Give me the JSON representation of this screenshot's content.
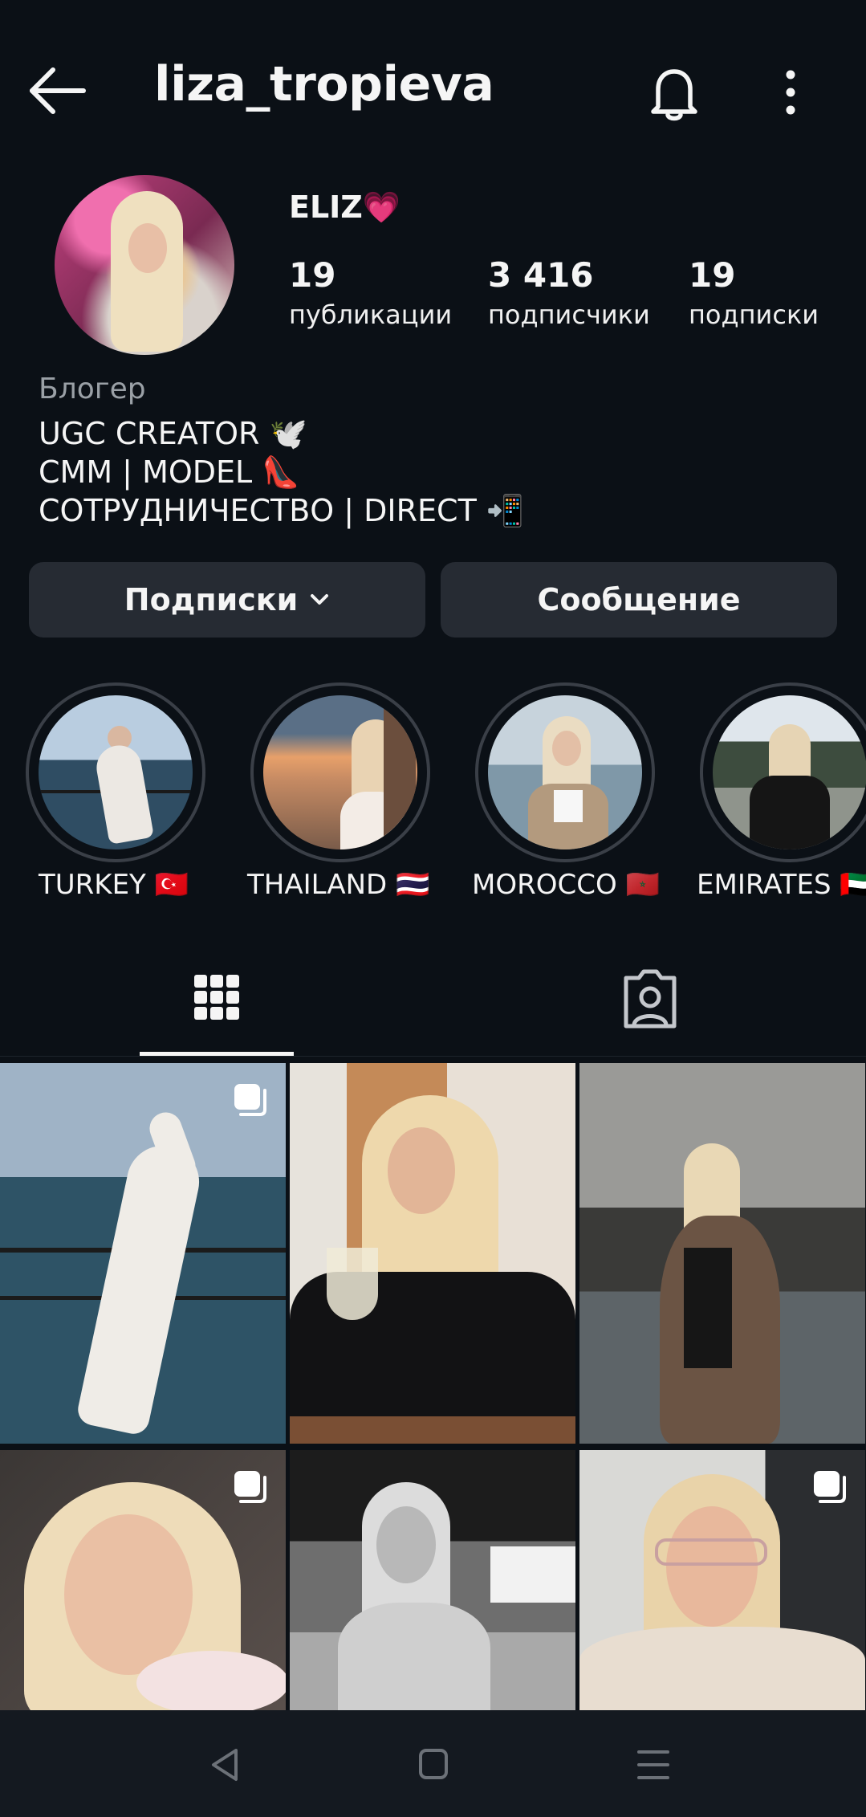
{
  "header": {
    "username": "liza_tropieva",
    "icons": [
      "back-arrow-icon",
      "bell-icon",
      "more-vertical-icon"
    ]
  },
  "profile": {
    "display_name": "ELIZ💗",
    "stats": [
      {
        "value": "19",
        "label": "публикации"
      },
      {
        "value": "3 416",
        "label": "подписчики"
      },
      {
        "value": "19",
        "label": "подписки"
      }
    ],
    "category": "Блогер",
    "bio": [
      "UGC CREATOR 🕊️",
      "CMM | MODEL 👠",
      "СОТРУДНИЧЕСТВО | DIRECT 📲"
    ]
  },
  "actions": {
    "following_label": "Подписки",
    "message_label": "Сообщение"
  },
  "highlights": [
    {
      "label": "TURKEY 🇹🇷"
    },
    {
      "label": "THAILAND 🇹🇭"
    },
    {
      "label": "MOROCCO 🇲🇦"
    },
    {
      "label": "EMIRATES 🇦🇪"
    }
  ],
  "tabs": [
    {
      "name": "posts-grid",
      "icon": "grid-icon",
      "selected": true
    },
    {
      "name": "tagged",
      "icon": "tagged-person-icon",
      "selected": false
    }
  ],
  "posts": [
    {
      "multi": true,
      "bw": false
    },
    {
      "multi": false,
      "bw": false
    },
    {
      "multi": false,
      "bw": false
    },
    {
      "multi": true,
      "bw": false
    },
    {
      "multi": false,
      "bw": true
    },
    {
      "multi": true,
      "bw": false
    }
  ],
  "navbar": {
    "icons": [
      "nav-back-icon",
      "nav-home-icon",
      "nav-recents-icon"
    ]
  },
  "colors": {
    "background": "#0b1016",
    "button": "#262b33",
    "secondary_text": "#9aa0a6"
  }
}
